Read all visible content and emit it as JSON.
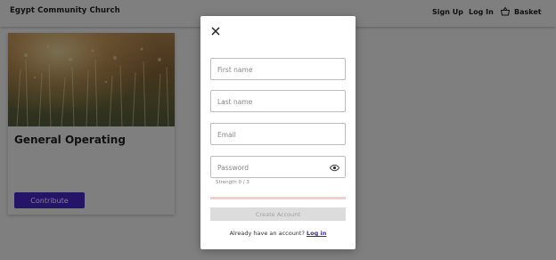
{
  "header": {
    "brand": "Egypt Community Church",
    "sign_up": "Sign Up",
    "log_in": "Log In",
    "basket": "Basket"
  },
  "fund_card": {
    "title": "General Operating",
    "contribute_label": "Contribute"
  },
  "signup_modal": {
    "first_name_placeholder": "First name",
    "last_name_placeholder": "Last name",
    "email_placeholder": "Email",
    "password_placeholder": "Password",
    "strength_text": "Strength 0 / 3",
    "strength_value": 0,
    "strength_max": 3,
    "create_account_label": "Create Account",
    "already_have_account": "Already have an account?",
    "log_in_link": "Log in"
  },
  "colors": {
    "primary": "#4a2bd1",
    "link": "#3a2aa0",
    "strength_track": "#f2cfcf"
  },
  "icons": {
    "close": "close-icon",
    "basket": "basket-icon",
    "password_visibility": "eye-icon"
  }
}
